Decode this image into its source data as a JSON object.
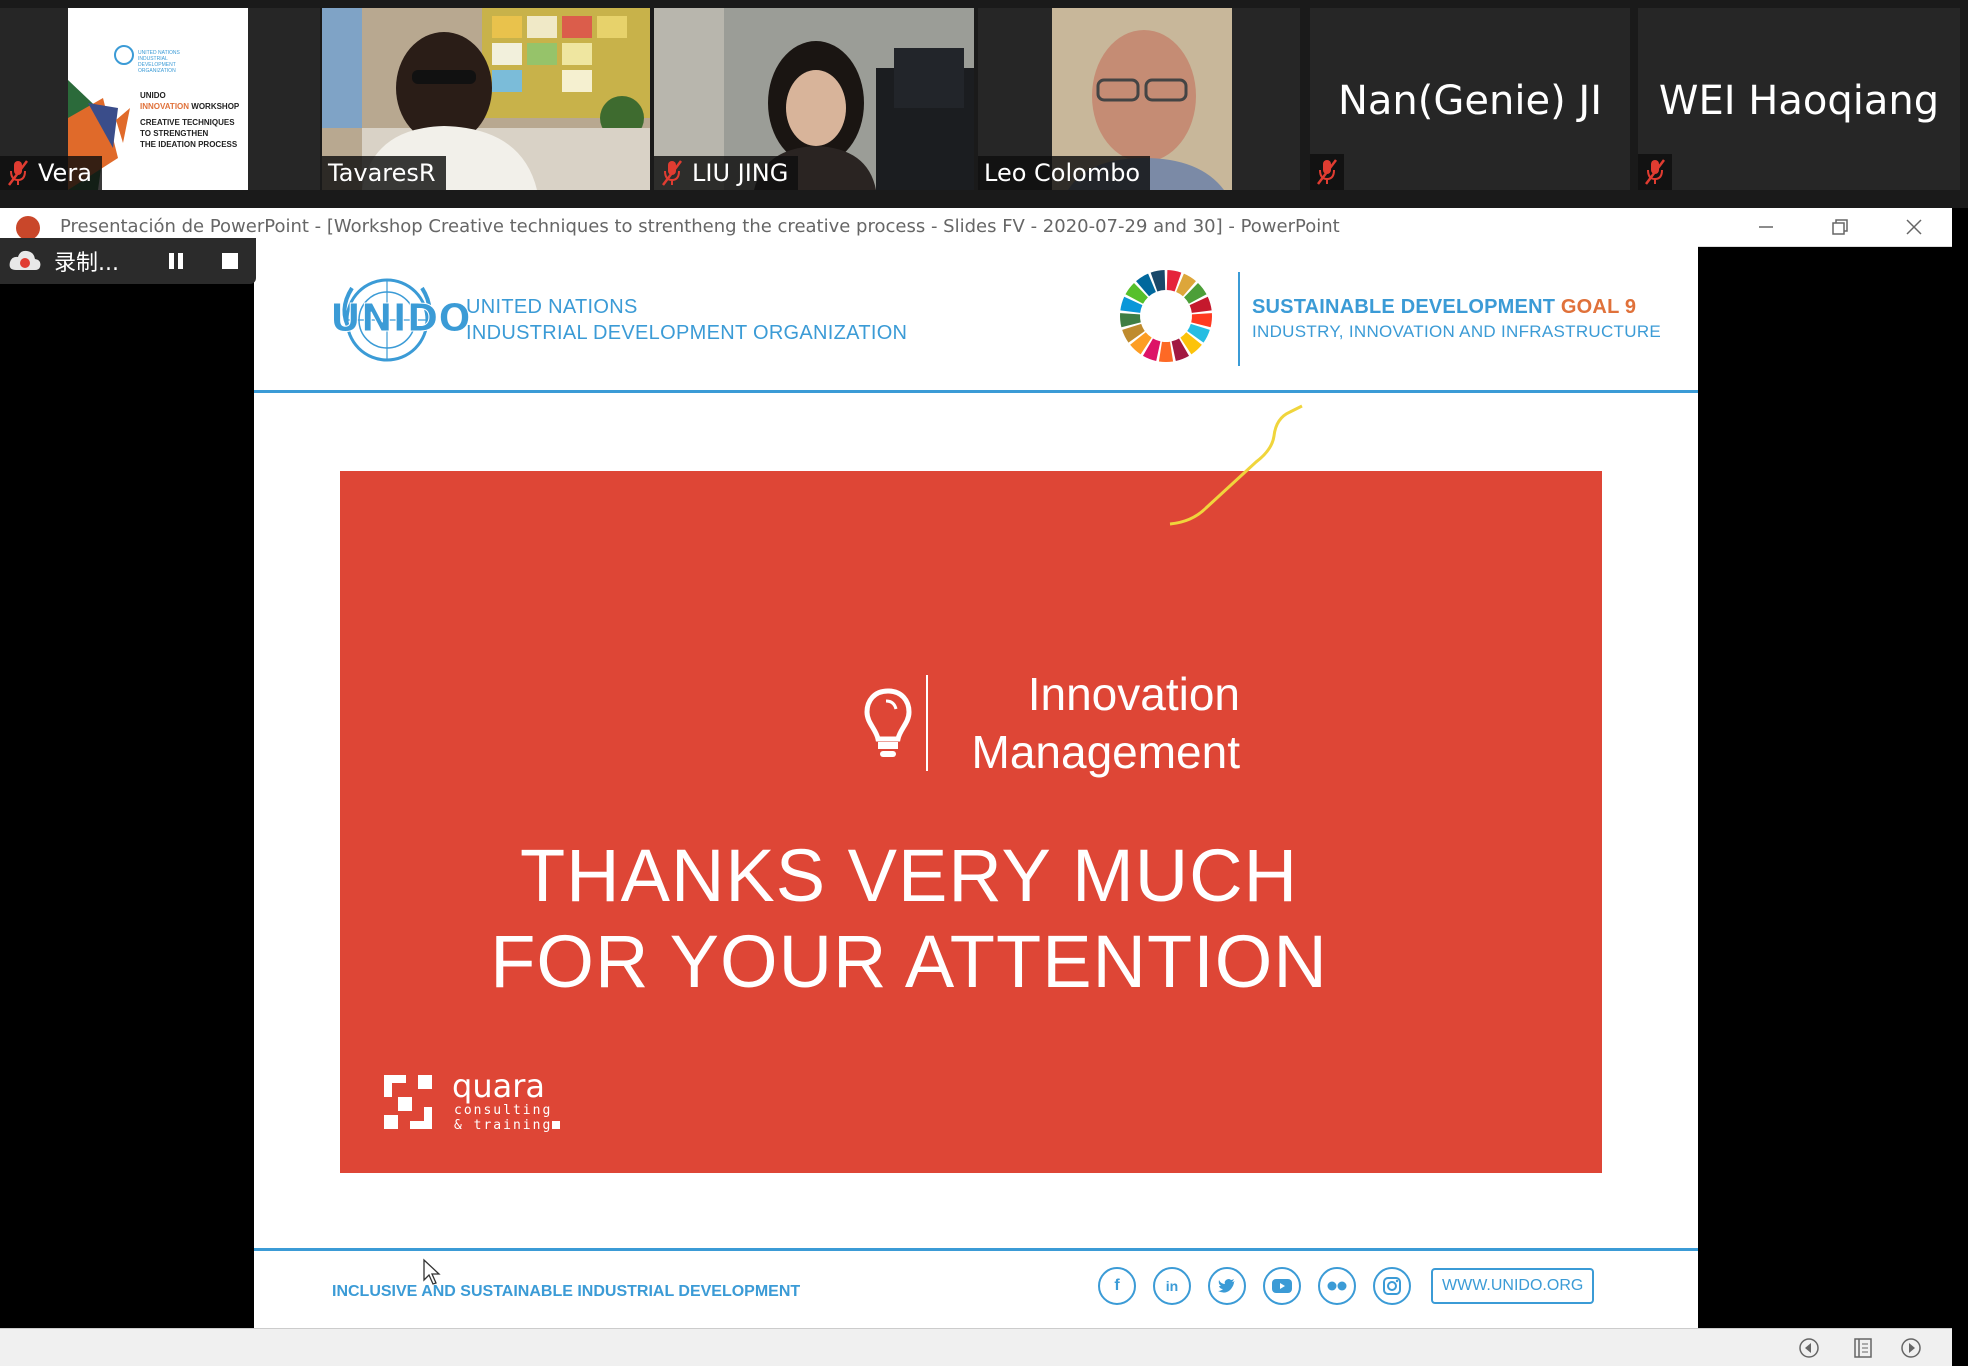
{
  "participants": [
    {
      "name": "Vera",
      "muted": true
    },
    {
      "name": "TavaresR",
      "muted": false,
      "active": true
    },
    {
      "name": "LIU JING",
      "muted": true
    },
    {
      "name": "Leo Colombo",
      "muted": false
    },
    {
      "name": "Nan(Genie) JI",
      "muted": true
    },
    {
      "name": "WEI Haoqiang",
      "muted": true
    }
  ],
  "vera_thumbnail": {
    "org_small": "UNITED NATIONS INDUSTRIAL DEVELOPMENT ORGANIZATION",
    "line1": "UNIDO",
    "line2_a": "INNOVATION",
    "line2_b": " WORKSHOP",
    "line3": "CREATIVE TECHNIQUES",
    "line4": "TO STRENGTHEN",
    "line5": "THE IDEATION PROCESS"
  },
  "window": {
    "title": "Presentación de PowerPoint - [Workshop Creative techniques to strentheng the creative process - Slides FV - 2020-07-29 and 30] - PowerPoint"
  },
  "recording": {
    "label": "录制..."
  },
  "slide": {
    "unido_logo": "UNIDO",
    "org_line1": "UNITED NATIONS",
    "org_line2": "INDUSTRIAL DEVELOPMENT ORGANIZATION",
    "sdg_line1_a": "SUSTAINABLE DEVELOPMENT ",
    "sdg_line1_b": "GOAL 9",
    "sdg_line2": "INDUSTRY, INNOVATION AND INFRASTRUCTURE",
    "innovation_1": "Innovation",
    "innovation_2": "Management",
    "thanks_1": "THANKS VERY MUCH",
    "thanks_2": "FOR YOUR ATTENTION",
    "quara_brand": "quara",
    "quara_sub1": "consulting",
    "quara_sub2": "& training",
    "footer": "INCLUSIVE AND SUSTAINABLE INDUSTRIAL DEVELOPMENT",
    "url": "WWW.UNIDO.ORG",
    "social_icons": [
      "facebook-icon",
      "linkedin-icon",
      "twitter-icon",
      "youtube-icon",
      "flickr-icon",
      "instagram-icon"
    ]
  },
  "colors": {
    "unido_blue": "#3b9bd6",
    "panel_red": "#de4636",
    "sdg_orange": "#e0713a",
    "active_speaker": "#d8de6a",
    "annotation": "#f0d53c"
  }
}
